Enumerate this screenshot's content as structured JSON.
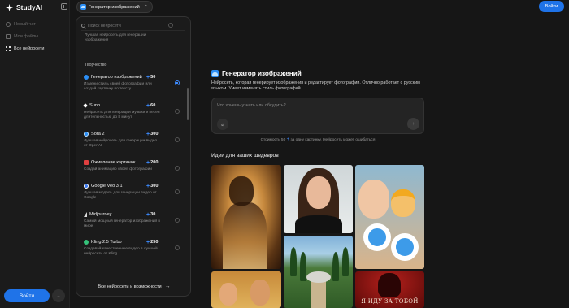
{
  "sidebar": {
    "brand": "StudyAI",
    "items": [
      {
        "label": "Новый чат",
        "icon": "chat-icon"
      },
      {
        "label": "Мои файлы",
        "icon": "file-icon"
      },
      {
        "label": "Все нейросети",
        "icon": "grid-icon"
      }
    ],
    "login_label": "Войти",
    "more_icon": "chevron-down-icon"
  },
  "header": {
    "selected_model": "Генератор изображений",
    "login_label": "Войти"
  },
  "dropdown": {
    "search_placeholder": "Поиск нейросети",
    "first_item_desc": "Лучшая нейросеть для генерации изображения",
    "section_label": "Творчество",
    "items": [
      {
        "name": "Генератор изображений",
        "cost": "50",
        "desc": "Измени стиль своей фотографии или создай картинку по тексту",
        "color": "#2b8ef5",
        "selected": true
      },
      {
        "name": "Suno",
        "cost": "60",
        "desc": "Нейросеть для генерации музыки и песен длительностью до 8 минут",
        "color": "#ffffff",
        "selected": false
      },
      {
        "name": "Sora 2",
        "cost": "300",
        "desc": "Лучшая нейросеть для генерации видео от OpenAI",
        "color": "#2b8ef5",
        "selected": false
      },
      {
        "name": "Оживление картинок",
        "cost": "200",
        "desc": "Создай анимацию своей фотографии",
        "color": "#e04040",
        "selected": false
      },
      {
        "name": "Google Veo 3.1",
        "cost": "300",
        "desc": "Лучшая модель для генерации видео от Google",
        "color": "#3d7bf0",
        "selected": false
      },
      {
        "name": "Midjourney",
        "cost": "30",
        "desc": "Самый мощный генератор изображений в мире",
        "color": "#dddddd",
        "selected": false
      },
      {
        "name": "Kling 2.5 Turbo",
        "cost": "250",
        "desc": "Создавай качественные видео в лучшей нейросети от Kling",
        "color": "#35c27a",
        "selected": false
      }
    ],
    "footer_label": "Все нейросети и возможности"
  },
  "main": {
    "title": "Генератор изображений",
    "description": "Нейросеть, которая генерирует изображения и редактирует фотографии. Отлично работает с русским языком. Умеет изменять стиль фотографий",
    "prompt_placeholder": "Что хочешь узнать или обсудить?",
    "cost_note_prefix": "Стоимость 50",
    "cost_note_suffix": "за одну картинку. Нейросеть может ошибаться",
    "ideas_title": "Идеи для ваших шедевров",
    "tile_caption": "Я ИДУ ЗА ТОБОЙ"
  },
  "colors": {
    "accent": "#1f73e8",
    "background": "#161616"
  }
}
